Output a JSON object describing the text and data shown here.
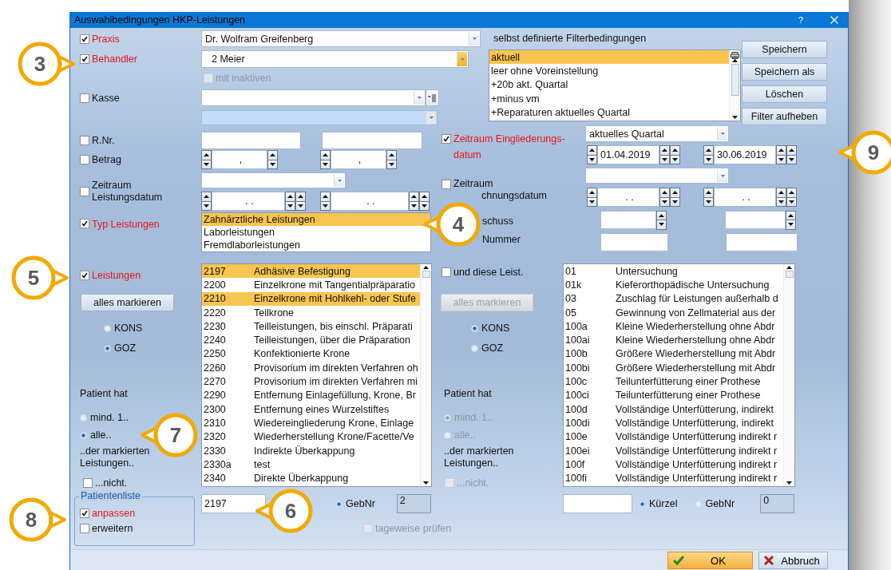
{
  "window": {
    "title": "Auswahlbedingungen HKP-Leistungen",
    "help": "?"
  },
  "praxis": {
    "label": "Praxis",
    "checked": true,
    "value": "Dr. Wolfram Greifenberg",
    "focused": false
  },
  "behandler": {
    "label": "Behandler",
    "checked": true,
    "value": "2 Meier",
    "focused": true
  },
  "mit_inaktiven": {
    "label": "mit inaktiven",
    "checked": false,
    "disabled": true
  },
  "kasse": {
    "label": "Kasse",
    "checked": false
  },
  "saved_filters": {
    "title": "selbst definierte Filterbedingungen",
    "items": [
      {
        "label": "aktuell",
        "selected": true
      },
      {
        "label": "leer ohne Voreinstellung",
        "selected": false
      },
      {
        "label": "+20b akt. Quartal",
        "selected": false
      },
      {
        "label": "+minus vm",
        "selected": false
      },
      {
        "label": "+Reparaturen aktuelles Quartal",
        "selected": false
      }
    ]
  },
  "filter_buttons": [
    "Speichern",
    "Speichern als",
    "Löschen",
    "Filter aufheben"
  ],
  "rnr": {
    "label": "R.Nr.",
    "checked": false
  },
  "betrag": {
    "label": "Betrag",
    "checked": false,
    "from": ",",
    "to": ","
  },
  "zeitraum_leistung": {
    "label": "Zeitraum Leistungsdatum",
    "checked": false,
    "from": ". .",
    "to": ". ."
  },
  "typ_leistungen": {
    "label": "Typ Leistungen",
    "checked": true,
    "items": [
      {
        "label": "Zahnärztliche Leistungen",
        "selected": true
      },
      {
        "label": "Laborleistungen",
        "selected": false
      },
      {
        "label": "Fremdlaborleistungen",
        "selected": false
      }
    ]
  },
  "zeitraum_eingliederung": {
    "label": "Zeitraum Eingliederungs-datum",
    "checked": true,
    "period": "aktuelles Quartal",
    "from": "01.04.2019",
    "to": "30.06.2019"
  },
  "zeitraum_berechnung": {
    "label": "Zeitraum",
    "label_rest": "chnungsdatum",
    "checked": false,
    "from": ". .",
    "to": ". ."
  },
  "zuschuss": {
    "label": "schuss"
  },
  "nummer": {
    "label": "Nummer"
  },
  "services": [
    {
      "check": {
        "label": "Leistungen",
        "checked": true
      },
      "mark_all": {
        "label": "alles markieren",
        "disabled": false
      },
      "catalogs": [
        {
          "label": "KONS",
          "selected": false
        },
        {
          "label": "GOZ",
          "selected": true
        }
      ],
      "patient_label": "Patient hat",
      "scope_disabled": false,
      "scope": [
        {
          "label": "mind. 1..",
          "selected": false
        },
        {
          "label": "alle..",
          "selected": true
        }
      ],
      "scope_note": "..der markierten Leistungen..",
      "negate": {
        "label": "...nicht.",
        "checked": false,
        "disabled": false
      },
      "rows": [
        {
          "code": "2197",
          "text": "Adhäsive Befestigung",
          "selected": true
        },
        {
          "code": "2200",
          "text": "Einzelkrone mit Tangentialpräparatio",
          "selected": false
        },
        {
          "code": "2210",
          "text": "Einzelkrone mit Hohlkehl- oder Stufe",
          "selected": true
        },
        {
          "code": "2220",
          "text": "Teilkrone",
          "selected": false
        },
        {
          "code": "2230",
          "text": "Teilleistungen, bis einschl. Präparati",
          "selected": false
        },
        {
          "code": "2240",
          "text": "Teilleistungen, über die Präparation",
          "selected": false
        },
        {
          "code": "2250",
          "text": "Konfektionierte Krone",
          "selected": false
        },
        {
          "code": "2260",
          "text": "Provisorium im direkten Verfahren oh",
          "selected": false
        },
        {
          "code": "2270",
          "text": "Provisorium im direkten Verfahren mi",
          "selected": false
        },
        {
          "code": "2290",
          "text": "Entfernung Einlagefüllung, Krone, Br",
          "selected": false
        },
        {
          "code": "2300",
          "text": "Entfernung eines Wurzelstiftes",
          "selected": false
        },
        {
          "code": "2310",
          "text": "Wiedereingliederung Krone, Einlage",
          "selected": false
        },
        {
          "code": "2320",
          "text": "Wiederherstellung Krone/Facette/Ve",
          "selected": false
        },
        {
          "code": "2330",
          "text": "Indirekte Überkappung",
          "selected": false
        },
        {
          "code": "2330a",
          "text": "test",
          "selected": false
        },
        {
          "code": "2340",
          "text": "Direkte Überkappung",
          "selected": false
        }
      ],
      "search_value": "2197",
      "search_modes": [
        {
          "label": "GebNr",
          "selected": true
        }
      ],
      "count": "2"
    },
    {
      "check": {
        "label": "und diese Leist.",
        "checked": false
      },
      "mark_all": {
        "label": "alles markieren",
        "disabled": true
      },
      "catalogs": [
        {
          "label": "KONS",
          "selected": true
        },
        {
          "label": "GOZ",
          "selected": false
        }
      ],
      "patient_label": "Patient hat",
      "scope_disabled": true,
      "scope": [
        {
          "label": "mind. 1..",
          "selected": true
        },
        {
          "label": "alle..",
          "selected": false
        }
      ],
      "scope_note": "..der markierten Leistungen..",
      "negate": {
        "label": "...nicht.",
        "checked": false,
        "disabled": true
      },
      "rows": [
        {
          "code": "01",
          "text": "Untersuchung",
          "selected": false
        },
        {
          "code": "01k",
          "text": "Kieferorthopädische Untersuchung",
          "selected": false
        },
        {
          "code": "03",
          "text": "Zuschlag für Leistungen außerhalb d",
          "selected": false
        },
        {
          "code": "05",
          "text": "Gewinnung von Zellmaterial aus der",
          "selected": false
        },
        {
          "code": "100a",
          "text": "Kleine Wiederherstellung ohne Abdr",
          "selected": false
        },
        {
          "code": "100ai",
          "text": "Kleine Wiederherstellung ohne Abdr",
          "selected": false
        },
        {
          "code": "100b",
          "text": "Größere Wiederherstellung mit Abdr",
          "selected": false
        },
        {
          "code": "100bi",
          "text": "Größere Wiederherstellung mit Abdr",
          "selected": false
        },
        {
          "code": "100c",
          "text": "Teilunterfütterung einer Prothese",
          "selected": false
        },
        {
          "code": "100ci",
          "text": "Teilunterfütterung einer Prothese",
          "selected": false
        },
        {
          "code": "100d",
          "text": "Vollständige Unterfütterung, indirekt",
          "selected": false
        },
        {
          "code": "100di",
          "text": "Vollständige Unterfütterung, indirekt",
          "selected": false
        },
        {
          "code": "100e",
          "text": "Vollständige Unterfütterung indirekt r",
          "selected": false
        },
        {
          "code": "100ei",
          "text": "Vollständige Unterfütterung indirekt r",
          "selected": false
        },
        {
          "code": "100f",
          "text": "Vollständige Unterfütterung indirekt r",
          "selected": false
        },
        {
          "code": "100fi",
          "text": "Vollständige Unterfütterung indirekt r",
          "selected": false
        }
      ],
      "search_modes": [
        {
          "label": "Kürzel",
          "selected": true
        },
        {
          "label": "GebNr",
          "selected": false
        }
      ],
      "count": "0"
    }
  ],
  "patientenliste": {
    "title": "Patientenliste",
    "options": [
      {
        "label": "anpassen",
        "checked": true
      },
      {
        "label": "erweitern",
        "checked": false
      }
    ]
  },
  "tageweise": {
    "label": "tageweise prüfen",
    "checked": false
  },
  "buttons": [
    {
      "kind": "ok",
      "label": "OK"
    },
    {
      "kind": "cancel",
      "label": "Abbruch"
    }
  ],
  "callouts": [
    {
      "number": "3"
    },
    {
      "number": "4"
    },
    {
      "number": "5"
    },
    {
      "number": "6"
    },
    {
      "number": "7"
    },
    {
      "number": "8"
    },
    {
      "number": "9"
    }
  ]
}
